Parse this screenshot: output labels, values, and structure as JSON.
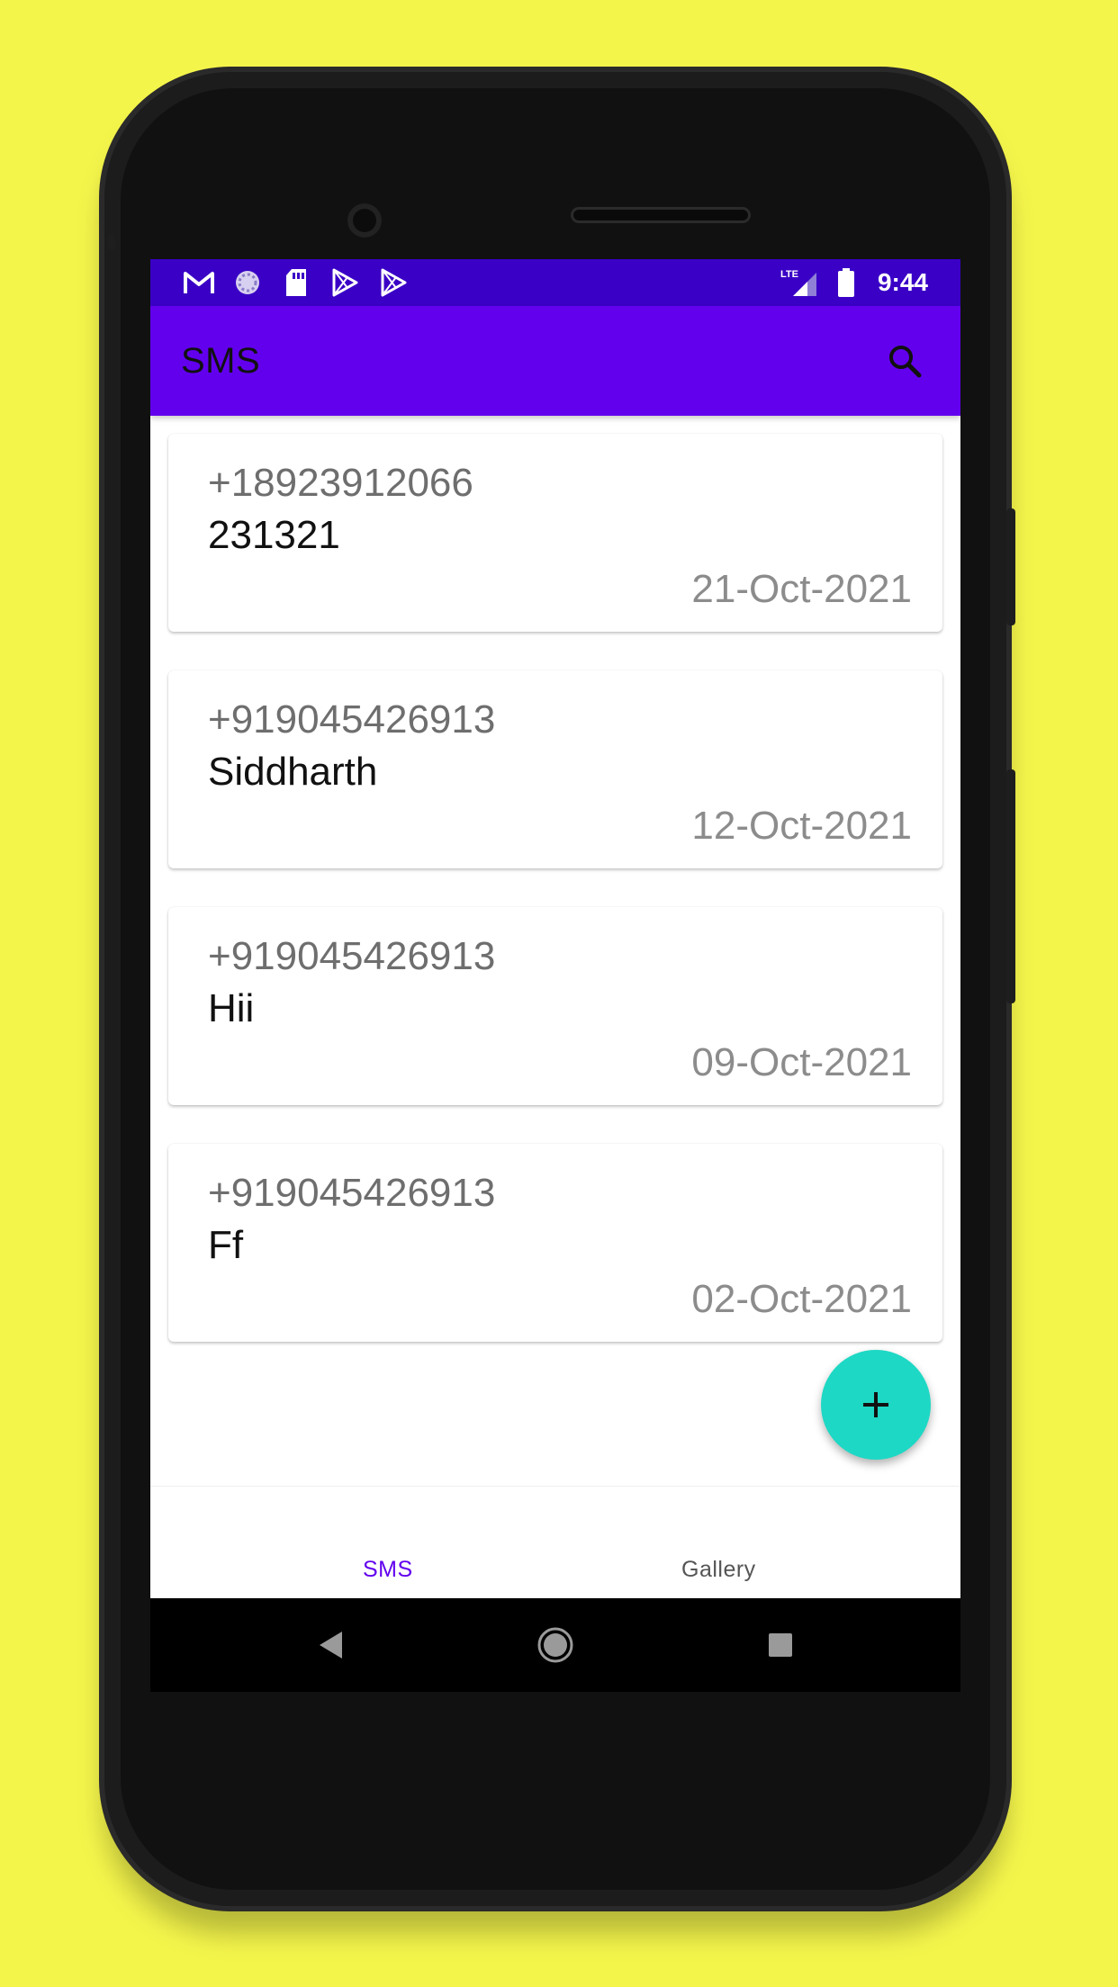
{
  "status_bar": {
    "time": "9:44",
    "left_icons": [
      "gmail-icon",
      "loading-icon",
      "sd-card-icon",
      "play-store-icon",
      "play-store-icon"
    ],
    "network_label": "LTE"
  },
  "app_bar": {
    "title": "SMS",
    "search_icon": "search-icon",
    "color": "#6200ee"
  },
  "messages": [
    {
      "number": "+18923912066",
      "body": "231321",
      "date": "21-Oct-2021"
    },
    {
      "number": "+919045426913",
      "body": "Siddharth",
      "date": "12-Oct-2021"
    },
    {
      "number": "+919045426913",
      "body": "Hii",
      "date": "09-Oct-2021"
    },
    {
      "number": "+919045426913",
      "body": "Ff",
      "date": "02-Oct-2021"
    }
  ],
  "fab": {
    "icon": "plus-icon",
    "color": "#1dd8c4"
  },
  "bottom_nav": {
    "items": [
      {
        "label": "SMS",
        "selected": true
      },
      {
        "label": "Gallery",
        "selected": false
      }
    ]
  },
  "system_nav": [
    "back-icon",
    "home-icon",
    "recents-icon"
  ]
}
